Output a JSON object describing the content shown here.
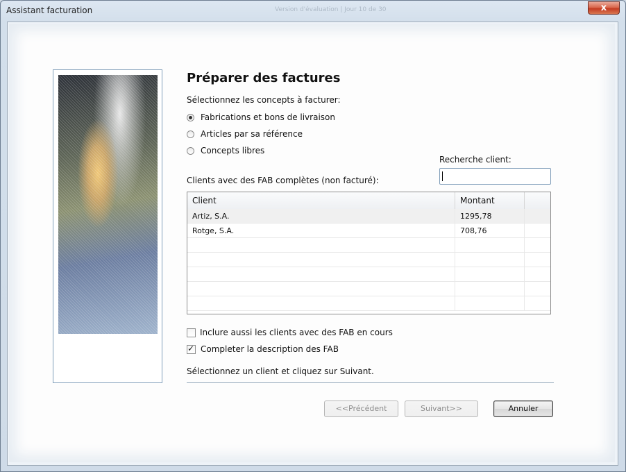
{
  "window": {
    "title": "Assistant facturation",
    "title_center": "Version d'évaluation | Jour 10 de 30",
    "close_label": "x"
  },
  "heading": "Préparer des factures",
  "concepts": {
    "prompt": "Sélectionnez les concepts à facturer:",
    "options": [
      {
        "label": "Fabrications et bons de livraison",
        "checked": true
      },
      {
        "label": "Articles par sa référence",
        "checked": false
      },
      {
        "label": "Concepts libres",
        "checked": false
      }
    ]
  },
  "search": {
    "label": "Recherche client:",
    "value": ""
  },
  "clients": {
    "label": "Clients avec des FAB complètes (non facturé):",
    "columns": [
      "Client",
      "Montant"
    ],
    "rows": [
      {
        "client": "Artiz, S.A.",
        "montant": "1295,78",
        "selected": true
      },
      {
        "client": "Rotge, S.A.",
        "montant": "708,76",
        "selected": false
      }
    ]
  },
  "options": {
    "include_in_progress": {
      "label": "Inclure aussi les clients avec des FAB en cours",
      "checked": false
    },
    "complete_description": {
      "label": "Completer la description des FAB",
      "checked": true
    }
  },
  "instruction": "Sélectionnez un client et cliquez sur Suivant.",
  "buttons": {
    "previous": {
      "label": "<<Précédent",
      "enabled": false
    },
    "next": {
      "label": "Suivant>>",
      "enabled": false
    },
    "cancel": {
      "label": "Annuler",
      "enabled": true
    }
  },
  "colors": {
    "title_bar": "#dde7f2",
    "close_button": "#c43c23",
    "border_accent": "#7f9db9"
  }
}
